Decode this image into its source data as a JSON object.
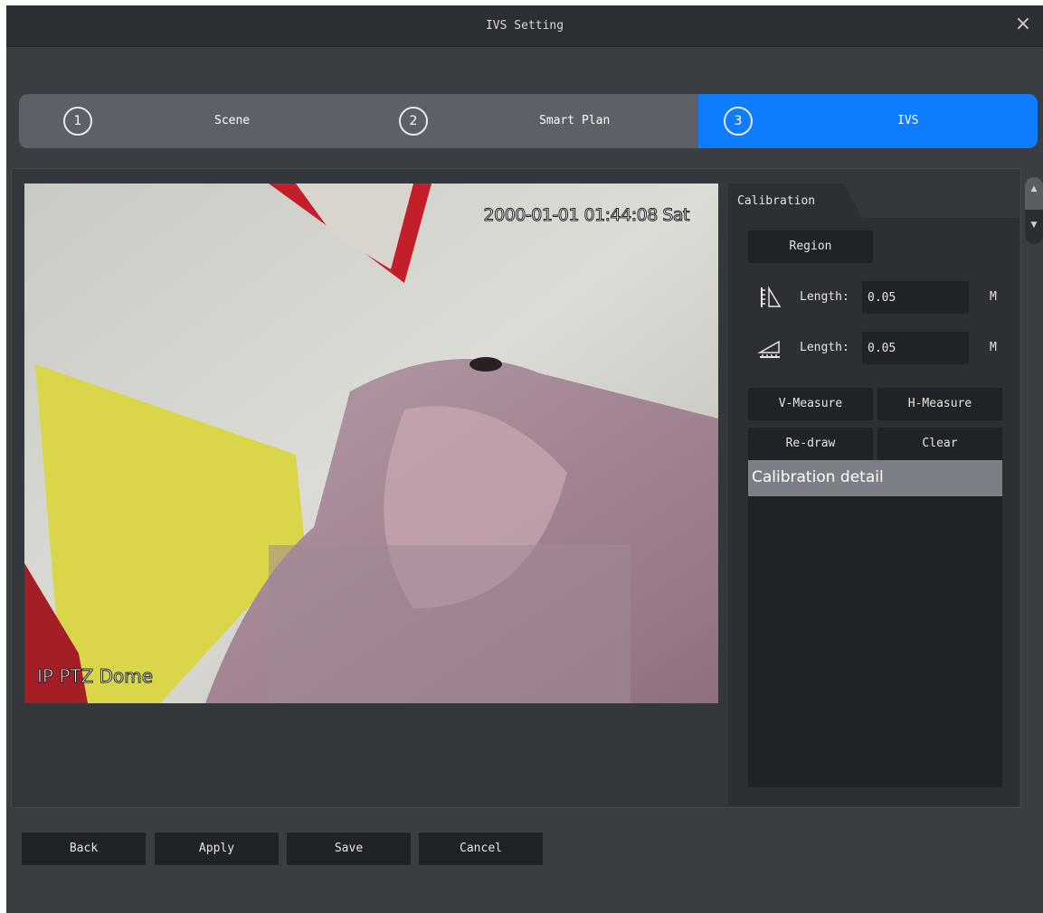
{
  "window": {
    "title": "IVS Setting",
    "close_icon": "close-icon"
  },
  "steps": [
    {
      "number": "1",
      "label": "Scene"
    },
    {
      "number": "2",
      "label": "Smart Plan"
    },
    {
      "number": "3",
      "label": "IVS"
    }
  ],
  "colors": {
    "accent": "#0f7bfd",
    "background": "#3a3d42",
    "panel": "#2c2f33",
    "control": "#1f2226"
  },
  "video": {
    "timestamp": "2000-01-01 01:44:08 Sat",
    "camera_name": "IP PTZ Dome"
  },
  "calibration": {
    "tab": "Calibration",
    "region_button": "Region",
    "vertical": {
      "icon": "vertical-ruler-icon",
      "label": "Length:",
      "value": "0.05",
      "unit": "M"
    },
    "horizontal": {
      "icon": "horizontal-ruler-icon",
      "label": "Length:",
      "value": "0.05",
      "unit": "M"
    },
    "v_measure_button": "V-Measure",
    "h_measure_button": "H-Measure",
    "redraw_button": "Re-draw",
    "clear_button": "Clear",
    "detail_header": "Calibration detail"
  },
  "footer": {
    "back": "Back",
    "apply": "Apply",
    "save": "Save",
    "cancel": "Cancel"
  }
}
